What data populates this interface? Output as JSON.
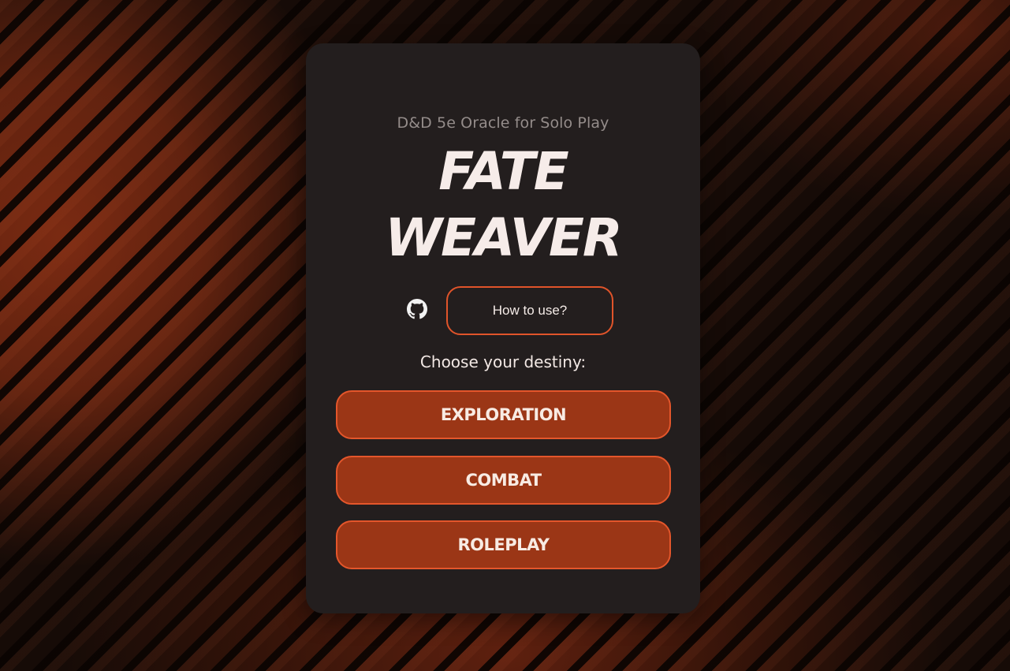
{
  "header": {
    "subtitle": "D&D 5e Oracle for Solo Play",
    "title_line1": "FATE",
    "title_line2": "WEAVER"
  },
  "links": {
    "github_icon": "github-icon",
    "howto_label": "How to use?"
  },
  "main": {
    "prompt": "Choose your destiny:",
    "choices": [
      {
        "label": "EXPLORATION"
      },
      {
        "label": "COMBAT"
      },
      {
        "label": "ROLEPLAY"
      }
    ]
  },
  "colors": {
    "card_bg": "#231e1e",
    "accent_border": "#e4562b",
    "button_fill": "#9b3616",
    "title_text": "#f6ece9"
  }
}
